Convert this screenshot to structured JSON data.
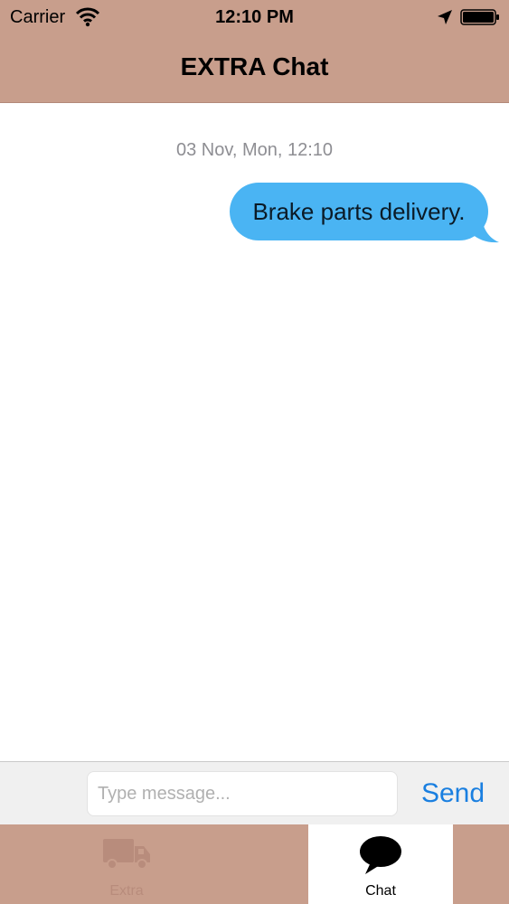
{
  "status_bar": {
    "carrier": "Carrier",
    "time": "12:10 PM",
    "icons": [
      "wifi-icon",
      "location-arrow-icon",
      "battery-icon"
    ]
  },
  "nav": {
    "title": "EXTRA Chat",
    "background_color": "#c89e8c"
  },
  "chat": {
    "timestamp": "03 Nov, Mon, 12:10",
    "messages": [
      {
        "text": "Brake parts delivery.",
        "direction": "outgoing",
        "bubble_color": "#4ab4f3"
      }
    ]
  },
  "input": {
    "value": "",
    "placeholder": "Type message...",
    "send_label": "Send",
    "send_color": "#1a7fe0"
  },
  "tabbar": {
    "tabs": [
      {
        "label": "Extra",
        "icon": "truck-icon",
        "selected": false
      },
      {
        "label": "Chat",
        "icon": "speech-bubble-icon",
        "selected": true
      }
    ]
  }
}
